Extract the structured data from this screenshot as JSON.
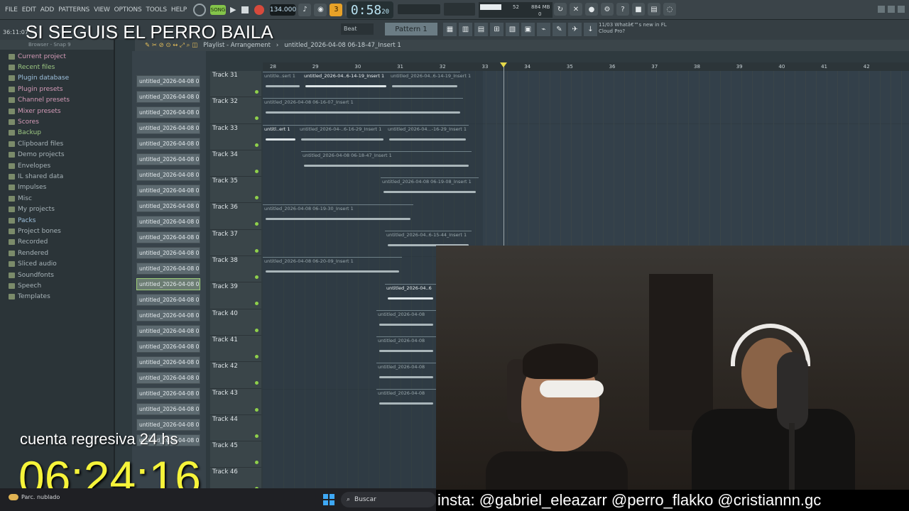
{
  "menu": [
    "FILE",
    "EDIT",
    "ADD",
    "PATTERNS",
    "VIEW",
    "OPTIONS",
    "TOOLS",
    "HELP"
  ],
  "transport": {
    "mode": "SONG",
    "tempo": "134.000",
    "time_main": "0:58",
    "time_sub": "20",
    "time_unit": "M:S:CS"
  },
  "cpu": {
    "value1": "52",
    "mem": "884 MB",
    "value2": "0"
  },
  "clock": "36:11:07",
  "snap": "Beat",
  "pattern": "Pattern 1",
  "news": {
    "line1": "11/03  Whatâ€™s new in FL",
    "line2": "Cloud Pro?"
  },
  "browser": {
    "header": "Browser - Snap 9",
    "items": [
      {
        "label": "Current project",
        "style": "pink"
      },
      {
        "label": "Recent files",
        "style": "green"
      },
      {
        "label": "Plugin database",
        "style": "blue"
      },
      {
        "label": "Plugin presets",
        "style": "pink"
      },
      {
        "label": "Channel presets",
        "style": "pink"
      },
      {
        "label": "Mixer presets",
        "style": "pink"
      },
      {
        "label": "Scores",
        "style": "pink"
      },
      {
        "label": "Backup",
        "style": "green"
      },
      {
        "label": "Clipboard files",
        "style": ""
      },
      {
        "label": "Demo projects",
        "style": ""
      },
      {
        "label": "Envelopes",
        "style": ""
      },
      {
        "label": "IL shared data",
        "style": ""
      },
      {
        "label": "Impulses",
        "style": ""
      },
      {
        "label": "Misc",
        "style": ""
      },
      {
        "label": "My projects",
        "style": ""
      },
      {
        "label": "Packs",
        "style": "blue"
      },
      {
        "label": "Project bones",
        "style": ""
      },
      {
        "label": "Recorded",
        "style": ""
      },
      {
        "label": "Rendered",
        "style": ""
      },
      {
        "label": "Sliced audio",
        "style": ""
      },
      {
        "label": "Soundfonts",
        "style": ""
      },
      {
        "label": "Speech",
        "style": ""
      },
      {
        "label": "Templates",
        "style": ""
      }
    ]
  },
  "clips_list": [
    "untitled_2026-04-08 05-...",
    "untitled_2026-04-08 05-...",
    "untitled_2026-04-08 05-...",
    "untitled_2026-04-08 05-...",
    "untitled_2026-04-08 05-...",
    "untitled_2026-04-08 05-...",
    "untitled_2026-04-08 05-...",
    "untitled_2026-04-08 06-...",
    "untitled_2026-04-08 06-...",
    "untitled_2026-04-08 06-...",
    "untitled_2026-04-08 06-...",
    "untitled_2026-04-08 06-...",
    "untitled_2026-04-08 06-...",
    "untitled_2026-04-08 06-...",
    "untitled_2026-04-08 06-...",
    "untitled_2026-04-08 06-...",
    "untitled_2026-04-08 06-...",
    "untitled_2026-04-08 06-...",
    "untitled_2026-04-08 06-...",
    "untitled_2026-04-08 06-...",
    "untitled_2026-04-08 06-...",
    "untitled_2026-04-08 06-...",
    "untitled_2026-04-08 06-...",
    "untitled_2026-04-08 06-..."
  ],
  "playlist": {
    "breadcrumb": "Playlist - Arrangement",
    "current": "untitled_2026-04-08 06-18-47_Insert 1",
    "ruler": [
      "28",
      "29",
      "30",
      "31",
      "32",
      "33",
      "34",
      "35",
      "36",
      "37",
      "38",
      "39",
      "40",
      "41",
      "42"
    ],
    "tracks": [
      "Track 31",
      "Track 32",
      "Track 33",
      "Track 34",
      "Track 35",
      "Track 36",
      "Track 37",
      "Track 38",
      "Track 39",
      "Track 40",
      "Track 41",
      "Track 42",
      "Track 43",
      "Track 44",
      "Track 45",
      "Track 46"
    ],
    "clip_labels": {
      "t31a": "untitle..sert 1",
      "t31b": "untitled_2026-04..6-14-19_Insert 1",
      "t31c": "untitled_2026-04..6-14-19_Insert 1",
      "t32": "untitled_2026-04-08 06-16-07_Insert 1",
      "t33a": "untitl..ert 1",
      "t33b": "untitled_2026-04-..6-16-29_Insert 1",
      "t33c": "untitled_2026-04...-16-29_Insert 1",
      "t34": "untitled_2026-04-08 06-18-47_Insert 1",
      "t35": "untitled_2026-04-08 06-19-08_Insert 1",
      "t36": "untitled_2026-04-08 06-19-30_Insert 1",
      "t37": "untitled_2026-04..6-15-44_Insert 1",
      "t38": "untitled_2026-04-08 06-20-09_Insert 1",
      "t39": "untitled_2026-04..6",
      "t40": "untitled_2026-04-08",
      "t41": "untitled_2026-04-08",
      "t42": "untitled_2026-04-08",
      "t43": "untitled_2026-04-08"
    }
  },
  "overlay": {
    "title": "SI SEGUIS EL PERRO BAILA",
    "countdown_label": "cuenta regresiva 24 hs",
    "countdown": "06:24:16",
    "insta": "insta: @gabriel_eleazarr @perro_flakko @cristiannn.gc"
  },
  "taskbar": {
    "weather": "Parc. nublado",
    "search": "Buscar"
  }
}
